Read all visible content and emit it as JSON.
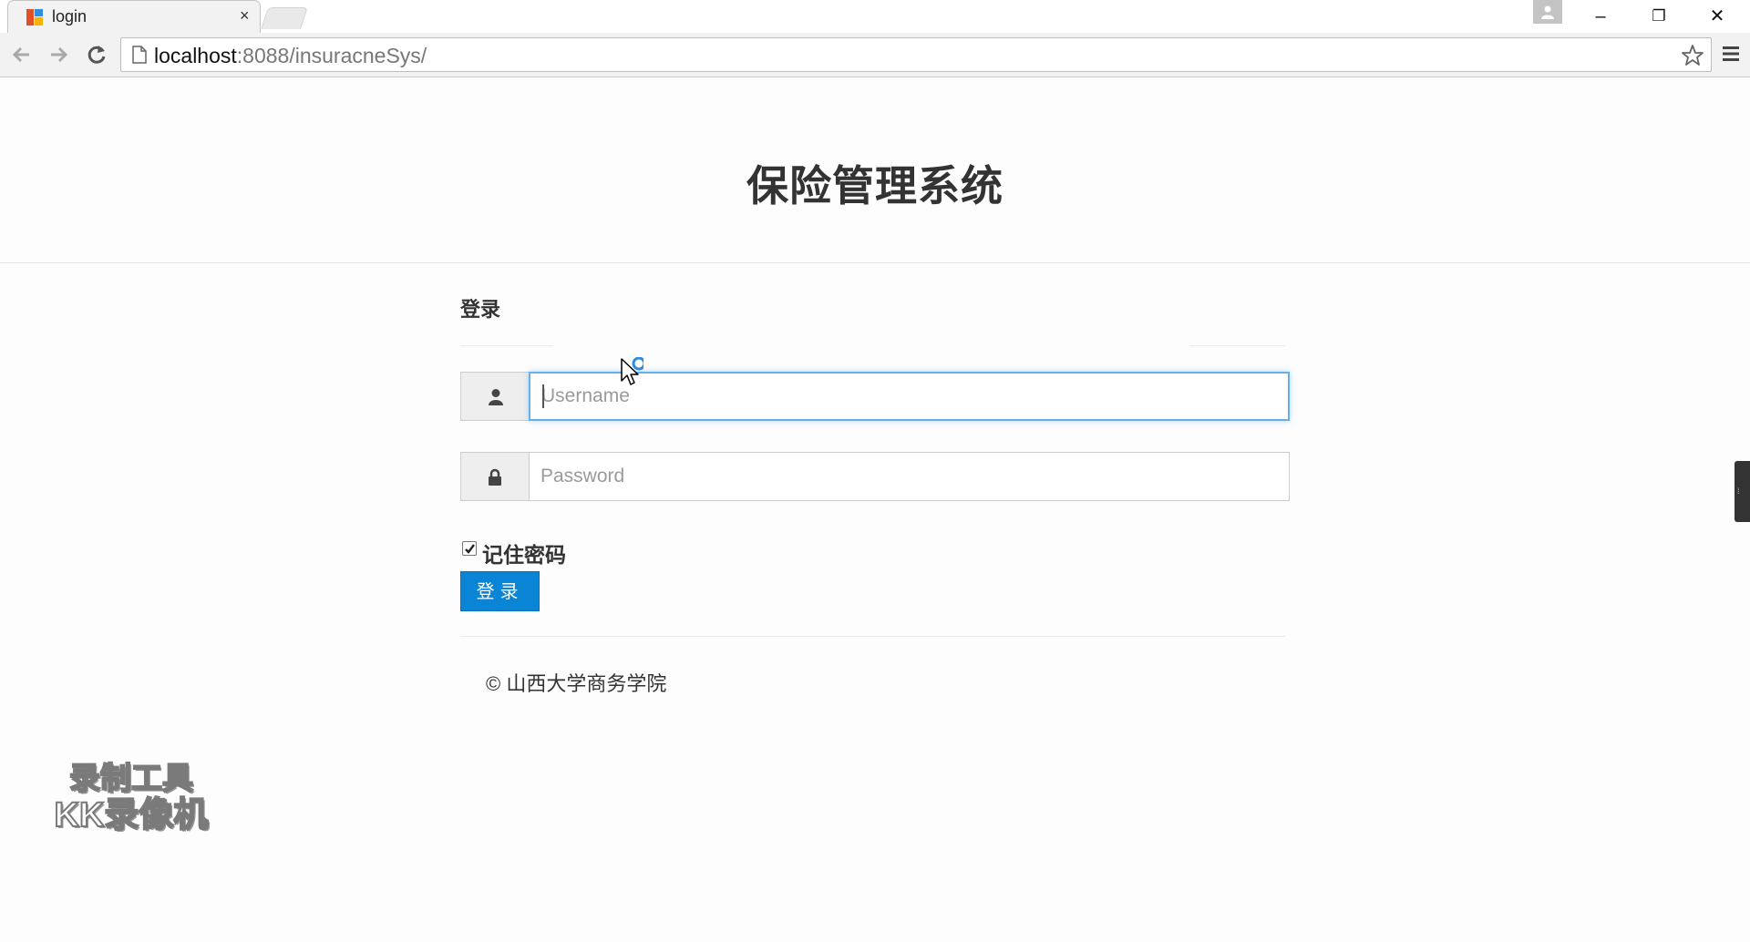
{
  "browser": {
    "tab_title": "login",
    "tab_close": "×",
    "url_host": "localhost",
    "url_path": ":8088/insuracneSys/",
    "window_controls": {
      "minimize": "–",
      "restore": "❐",
      "close": "✕"
    }
  },
  "header": {
    "title": "保险管理系统"
  },
  "login": {
    "heading": "登录",
    "username_placeholder": "Username",
    "password_placeholder": "Password",
    "remember_label": "记住密码",
    "remember_checked": true,
    "submit_label": "登录"
  },
  "footer": {
    "copyright": "© 山西大学商务学院"
  },
  "watermark": {
    "line1": "录制工具",
    "line2": "KK录像机"
  },
  "colors": {
    "primary_button": "#0a84d4",
    "focus_border": "#66afe9",
    "heading_text": "#333333"
  },
  "icons": [
    "user-icon",
    "lock-icon",
    "checkbox-checked-icon",
    "star-icon",
    "menu-icon",
    "back-icon",
    "forward-icon",
    "reload-icon",
    "page-icon"
  ]
}
